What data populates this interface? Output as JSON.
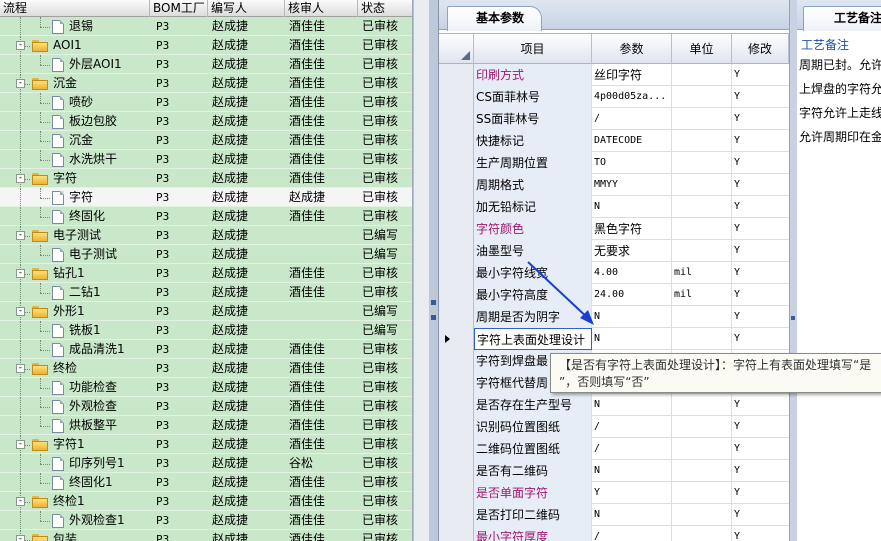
{
  "tree": {
    "columns": {
      "flow": "流程",
      "bom": "BOM工厂",
      "author": "编写人",
      "reviewer": "核审人",
      "status": "状态"
    },
    "rows": [
      {
        "level": 2,
        "type": "doc",
        "name": "退锡",
        "bom": "P3",
        "author": "赵成捷",
        "reviewer": "酒佳佳",
        "status": "已审核"
      },
      {
        "level": 1,
        "type": "folder",
        "name": "AOI1",
        "bom": "P3",
        "author": "赵成捷",
        "reviewer": "酒佳佳",
        "status": "已审核"
      },
      {
        "level": 2,
        "type": "doc",
        "name": "外层AOI1",
        "bom": "P3",
        "author": "赵成捷",
        "reviewer": "酒佳佳",
        "status": "已审核"
      },
      {
        "level": 1,
        "type": "folder",
        "name": "沉金",
        "bom": "P3",
        "author": "赵成捷",
        "reviewer": "酒佳佳",
        "status": "已审核"
      },
      {
        "level": 2,
        "type": "doc",
        "name": "喷砂",
        "bom": "P3",
        "author": "赵成捷",
        "reviewer": "酒佳佳",
        "status": "已审核"
      },
      {
        "level": 2,
        "type": "doc",
        "name": "板边包胶",
        "bom": "P3",
        "author": "赵成捷",
        "reviewer": "酒佳佳",
        "status": "已审核"
      },
      {
        "level": 2,
        "type": "doc",
        "name": "沉金",
        "bom": "P3",
        "author": "赵成捷",
        "reviewer": "酒佳佳",
        "status": "已审核"
      },
      {
        "level": 2,
        "type": "doc",
        "name": "水洗烘干",
        "bom": "P3",
        "author": "赵成捷",
        "reviewer": "酒佳佳",
        "status": "已审核"
      },
      {
        "level": 1,
        "type": "folder",
        "name": "字符",
        "bom": "P3",
        "author": "赵成捷",
        "reviewer": "酒佳佳",
        "status": "已审核"
      },
      {
        "level": 2,
        "type": "doc",
        "name": "字符",
        "bom": "P3",
        "author": "赵成捷",
        "reviewer": "赵成捷",
        "status": "已审核",
        "selected": true
      },
      {
        "level": 2,
        "type": "doc",
        "name": "终固化",
        "bom": "P3",
        "author": "赵成捷",
        "reviewer": "酒佳佳",
        "status": "已审核"
      },
      {
        "level": 1,
        "type": "folder",
        "name": "电子测试",
        "bom": "P3",
        "author": "赵成捷",
        "reviewer": "",
        "status": "已编写"
      },
      {
        "level": 2,
        "type": "doc",
        "name": "电子测试",
        "bom": "P3",
        "author": "赵成捷",
        "reviewer": "",
        "status": "已编写"
      },
      {
        "level": 1,
        "type": "folder",
        "name": "钻孔1",
        "bom": "P3",
        "author": "赵成捷",
        "reviewer": "酒佳佳",
        "status": "已审核"
      },
      {
        "level": 2,
        "type": "doc",
        "name": "二钻1",
        "bom": "P3",
        "author": "赵成捷",
        "reviewer": "酒佳佳",
        "status": "已审核"
      },
      {
        "level": 1,
        "type": "folder",
        "name": "外形1",
        "bom": "P3",
        "author": "赵成捷",
        "reviewer": "",
        "status": "已编写"
      },
      {
        "level": 2,
        "type": "doc",
        "name": "铣板1",
        "bom": "P3",
        "author": "赵成捷",
        "reviewer": "",
        "status": "已编写"
      },
      {
        "level": 2,
        "type": "doc",
        "name": "成品清洗1",
        "bom": "P3",
        "author": "赵成捷",
        "reviewer": "酒佳佳",
        "status": "已审核"
      },
      {
        "level": 1,
        "type": "folder",
        "name": "终检",
        "bom": "P3",
        "author": "赵成捷",
        "reviewer": "酒佳佳",
        "status": "已审核"
      },
      {
        "level": 2,
        "type": "doc",
        "name": "功能检查",
        "bom": "P3",
        "author": "赵成捷",
        "reviewer": "酒佳佳",
        "status": "已审核"
      },
      {
        "level": 2,
        "type": "doc",
        "name": "外观检查",
        "bom": "P3",
        "author": "赵成捷",
        "reviewer": "酒佳佳",
        "status": "已审核"
      },
      {
        "level": 2,
        "type": "doc",
        "name": "烘板整平",
        "bom": "P3",
        "author": "赵成捷",
        "reviewer": "酒佳佳",
        "status": "已审核"
      },
      {
        "level": 1,
        "type": "folder",
        "name": "字符1",
        "bom": "P3",
        "author": "赵成捷",
        "reviewer": "酒佳佳",
        "status": "已审核"
      },
      {
        "level": 2,
        "type": "doc",
        "name": "印序列号1",
        "bom": "P3",
        "author": "赵成捷",
        "reviewer": "谷松",
        "status": "已审核"
      },
      {
        "level": 2,
        "type": "doc",
        "name": "终固化1",
        "bom": "P3",
        "author": "赵成捷",
        "reviewer": "酒佳佳",
        "status": "已审核"
      },
      {
        "level": 1,
        "type": "folder",
        "name": "终检1",
        "bom": "P3",
        "author": "赵成捷",
        "reviewer": "酒佳佳",
        "status": "已审核"
      },
      {
        "level": 2,
        "type": "doc",
        "name": "外观检查1",
        "bom": "P3",
        "author": "赵成捷",
        "reviewer": "酒佳佳",
        "status": "已审核"
      },
      {
        "level": 1,
        "type": "folder",
        "name": "包装",
        "bom": "P3",
        "author": "赵成捷",
        "reviewer": "酒佳佳",
        "status": "已审核"
      }
    ]
  },
  "params": {
    "tab_label": "基本参数",
    "columns": {
      "item": "项目",
      "param": "参数",
      "unit": "单位",
      "modify": "修改"
    },
    "rows": [
      {
        "item": "印刷方式",
        "param": "丝印字符",
        "unit": "",
        "modify": "Y",
        "highlight": true,
        "cn": true
      },
      {
        "item": "CS面菲林号",
        "param": "4p00d05za...",
        "unit": "",
        "modify": "Y"
      },
      {
        "item": "SS面菲林号",
        "param": "/",
        "unit": "",
        "modify": "Y"
      },
      {
        "item": "快捷标记",
        "param": "DATECODE",
        "unit": "",
        "modify": "Y"
      },
      {
        "item": "生产周期位置",
        "param": "TO",
        "unit": "",
        "modify": "Y"
      },
      {
        "item": "周期格式",
        "param": "MMYY",
        "unit": "",
        "modify": "Y"
      },
      {
        "item": "加无铅标记",
        "param": "N",
        "unit": "",
        "modify": "Y"
      },
      {
        "item": "字符颜色",
        "param": "黑色字符",
        "unit": "",
        "modify": "Y",
        "highlight": true,
        "cn": true
      },
      {
        "item": "油墨型号",
        "param": "无要求",
        "unit": "",
        "modify": "Y",
        "cn": true
      },
      {
        "item": "最小字符线宽",
        "param": "4.00",
        "unit": "mil",
        "modify": "Y"
      },
      {
        "item": "最小字符高度",
        "param": "24.00",
        "unit": "mil",
        "modify": "Y"
      },
      {
        "item": "周期是否为阴字",
        "param": "N",
        "unit": "",
        "modify": "Y"
      },
      {
        "item": "字符上表面处理设计",
        "param": "N",
        "unit": "",
        "modify": "Y",
        "current": true
      },
      {
        "item": "字符到焊盘最",
        "param": "",
        "unit": "",
        "modify": ""
      },
      {
        "item": "字符框代替周",
        "param": "",
        "unit": "",
        "modify": ""
      },
      {
        "item": "是否存在生产型号",
        "param": "N",
        "unit": "",
        "modify": "Y"
      },
      {
        "item": "识别码位置图纸",
        "param": "/",
        "unit": "",
        "modify": "Y"
      },
      {
        "item": "二维码位置图纸",
        "param": "/",
        "unit": "",
        "modify": "Y"
      },
      {
        "item": "是否有二维码",
        "param": "N",
        "unit": "",
        "modify": "Y"
      },
      {
        "item": "是否单面字符",
        "param": "Y",
        "unit": "",
        "modify": "Y",
        "highlight": true
      },
      {
        "item": "是否打印二维码",
        "param": "N",
        "unit": "",
        "modify": "Y"
      },
      {
        "item": "最小字符厚度",
        "param": "/",
        "unit": "",
        "modify": "Y",
        "highlight": true
      }
    ]
  },
  "tooltip": {
    "line1": "【是否有字符上表面处理设计】：字符上有表面处理填写“是",
    "line2": "”，否则填写“否”"
  },
  "notes": {
    "tab_label": "工艺备注",
    "title": "工艺备注",
    "lines": [
      "周期已封。允许",
      "上焊盘的字符允",
      "字符允许上走线",
      "允许周期印在金"
    ]
  },
  "colors": {
    "tree_bg": "#c9e7c9",
    "highlight_text": "#a0186e",
    "arrow": "#1a3fd0"
  }
}
